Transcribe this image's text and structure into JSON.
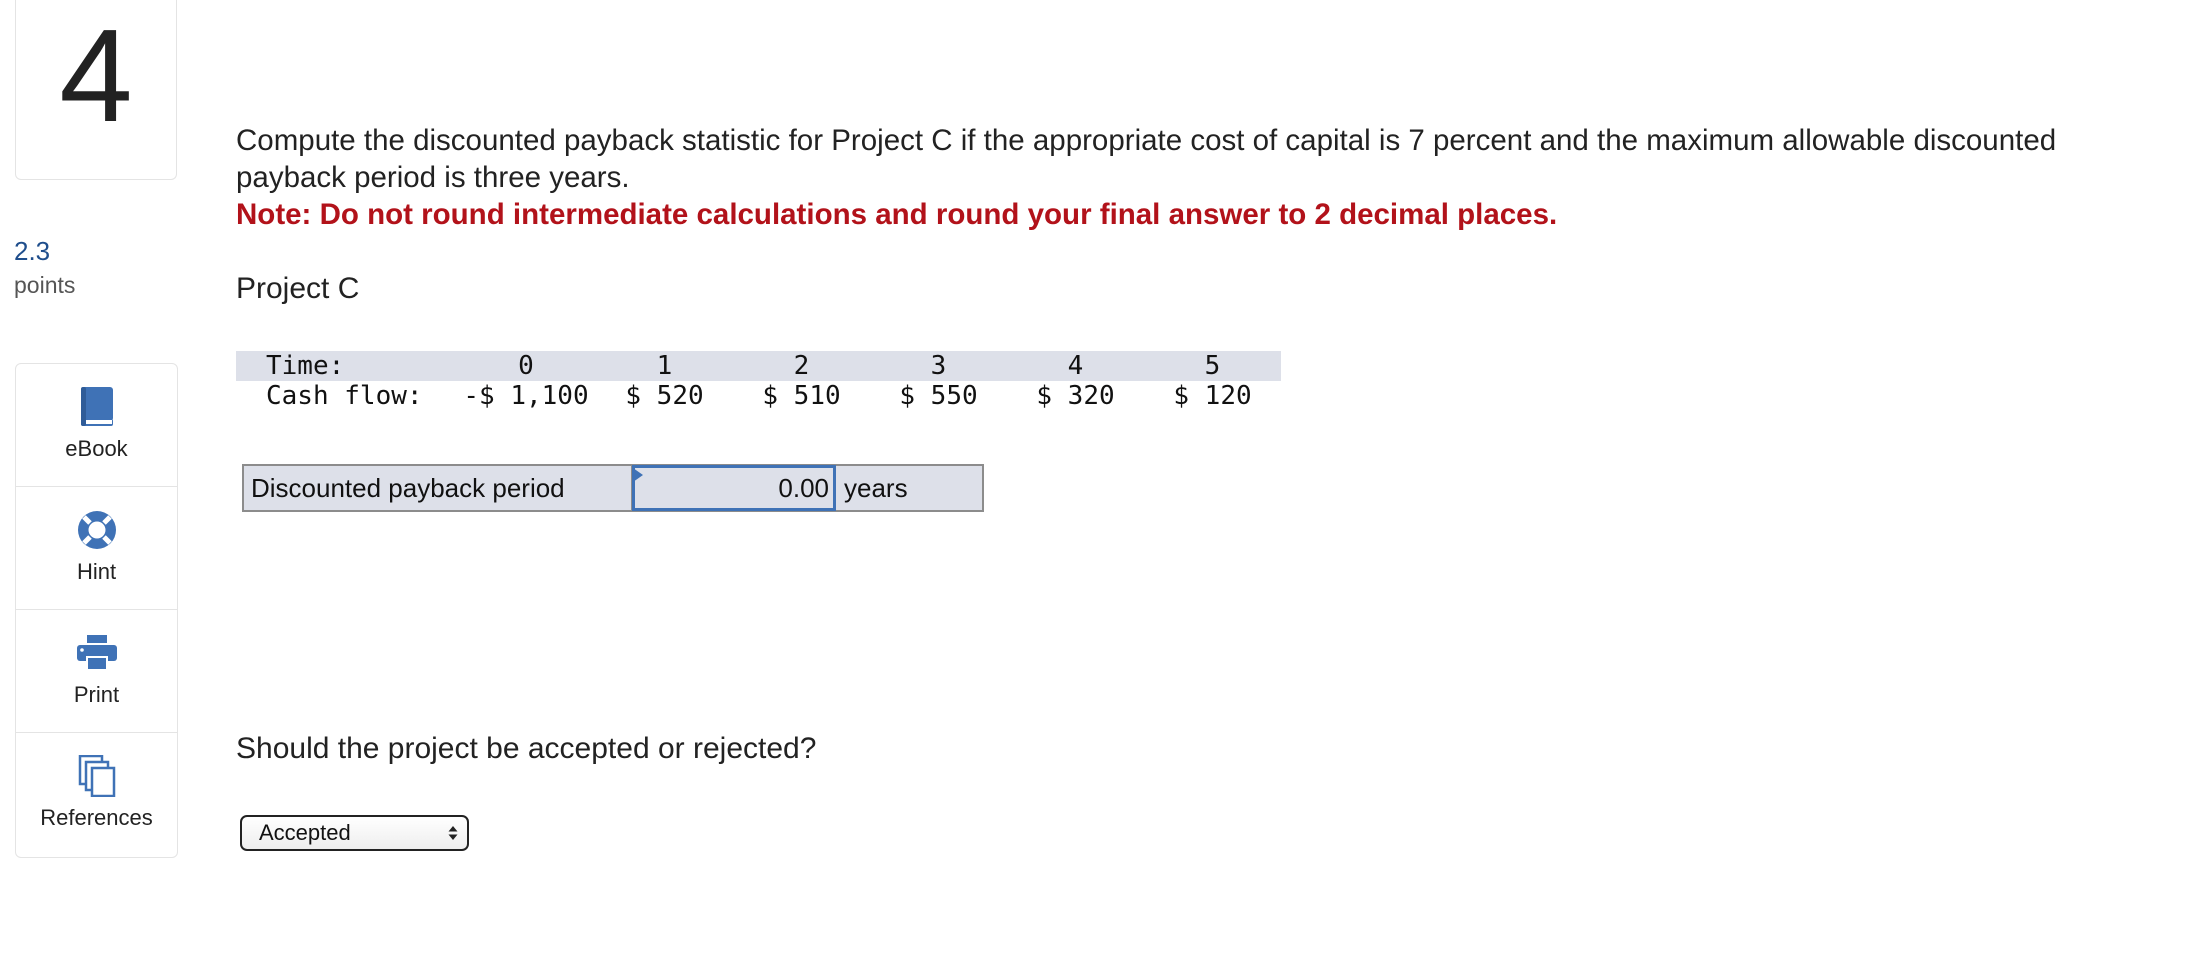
{
  "question_number": "4",
  "points": {
    "value": "2.3",
    "label": "points"
  },
  "tools": [
    {
      "label": "eBook",
      "icon": "book-icon"
    },
    {
      "label": "Hint",
      "icon": "lifebuoy-icon"
    },
    {
      "label": "Print",
      "icon": "printer-icon"
    },
    {
      "label": "References",
      "icon": "documents-icon"
    }
  ],
  "question": {
    "text": "Compute the discounted payback statistic for Project C if the appropriate cost of capital is 7 percent and the maximum allowable discounted payback period is three years.",
    "note": "Note: Do not round intermediate calculations and round your final answer to 2 decimal places."
  },
  "project_title": "Project C",
  "cash_flow_table": {
    "time_label": "Time:",
    "cash_flow_label": "Cash flow:",
    "times": [
      "0",
      "1",
      "2",
      "3",
      "4",
      "5"
    ],
    "cash_flows": [
      "-$ 1,100",
      "$ 520",
      "$ 510",
      "$ 550",
      "$ 320",
      "$ 120"
    ]
  },
  "answer": {
    "label": "Discounted payback period",
    "value": "0.00",
    "unit": "years"
  },
  "question2": "Should the project be accepted or rejected?",
  "decision_select": {
    "selected": "Accepted"
  },
  "colors": {
    "accent_blue": "#3f72b6",
    "note_red": "#b2121a",
    "table_shade": "#dde0e9",
    "points_blue": "#1f4e8c"
  }
}
